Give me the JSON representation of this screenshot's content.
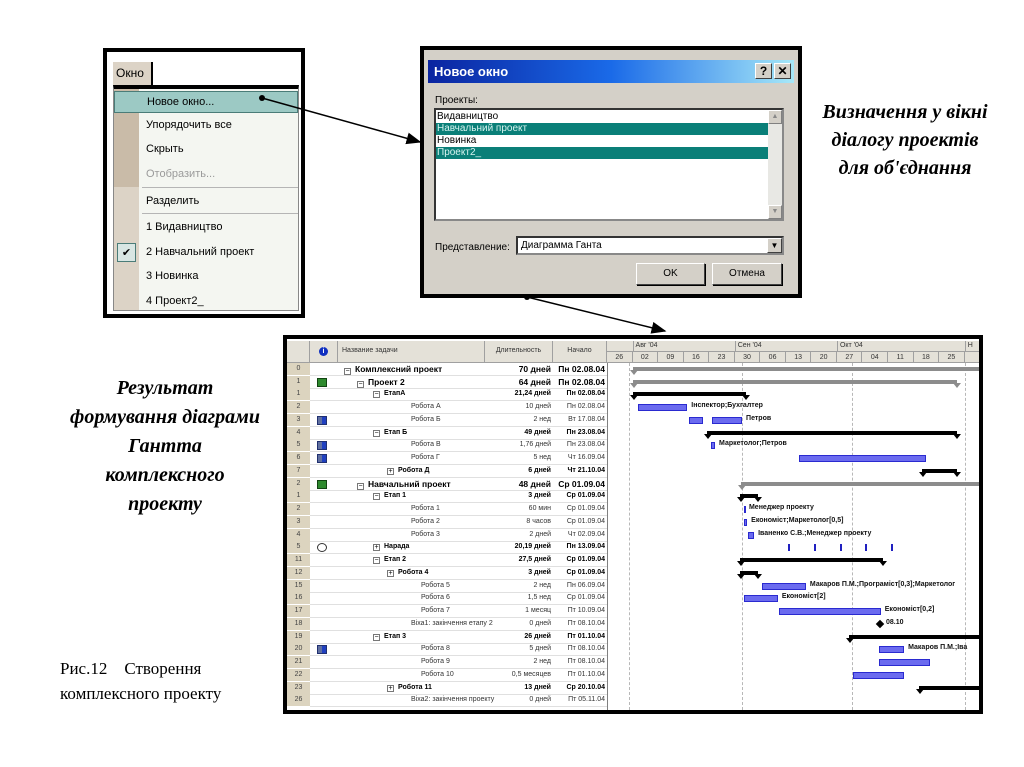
{
  "menu": {
    "tab_label": "Окно",
    "items": [
      {
        "label": "Новое окно...",
        "state": "highlighted"
      },
      {
        "label": "Упорядочить все",
        "state": "normal"
      },
      {
        "label": "Скрыть",
        "state": "normal"
      },
      {
        "label": "Отобразить...",
        "state": "disabled"
      },
      {
        "label": "Разделить",
        "state": "normal"
      },
      {
        "label": "1 Видавництво",
        "state": "normal"
      },
      {
        "label": "2 Навчальний проект",
        "state": "checked"
      },
      {
        "label": "3 Новинка",
        "state": "normal"
      },
      {
        "label": "4 Проект2_",
        "state": "normal"
      }
    ],
    "check_glyph": "✔"
  },
  "dialog": {
    "title": "Новое окно",
    "help_glyph": "?",
    "close_glyph": "✕",
    "projects_label": "Проекты:",
    "projects": [
      {
        "label": "Видавництво",
        "selected": false
      },
      {
        "label": "Навчальний проект",
        "selected": true
      },
      {
        "label": "Новинка",
        "selected": false
      },
      {
        "label": "Проект2_",
        "selected": true
      }
    ],
    "view_label": "Представление:",
    "view_value": "Диаграмма Ганта",
    "ok_label": "OK",
    "cancel_label": "Отмена"
  },
  "texts": {
    "right": "Визначення у вікні діалогу проектів для об'єднання",
    "left": "Результат формування діаграми Гантта комплексного проекту",
    "caption_1": "Рис.12    Створення",
    "caption_2": "комплексного проекту"
  },
  "gantt": {
    "headers": {
      "info_icon": "i",
      "name": "Название задачи",
      "duration": "Длительность",
      "start": "Начало"
    },
    "months": [
      {
        "label": "Авг '04",
        "day": 7
      },
      {
        "label": "Сен '04",
        "day": 35
      },
      {
        "label": "Окт '04",
        "day": 63
      },
      {
        "label": "Н",
        "day": 98
      }
    ],
    "weeks": [
      "26",
      "02",
      "09",
      "16",
      "23",
      "30",
      "06",
      "13",
      "20",
      "27",
      "04",
      "11",
      "18",
      "25"
    ],
    "month_lines": [
      6,
      37,
      67,
      98
    ],
    "colors": {
      "task": "#6b6bef",
      "summary": "#000000",
      "project": "#8c8c8c"
    },
    "rows": [
      {
        "id": "0",
        "ind": "",
        "name": "Комплексний проект",
        "lvl": 0,
        "box": "−",
        "b": true,
        "big": true,
        "dur": "70 дней",
        "start": "Пн 02.08.04",
        "g": {
          "t": "project",
          "s": 7,
          "e": 103
        }
      },
      {
        "id": "1",
        "ind": "project",
        "name": "Проект 2",
        "lvl": 1,
        "box": "−",
        "b": true,
        "big": true,
        "dur": "64 дней",
        "start": "Пн 02.08.04",
        "g": {
          "t": "project",
          "s": 7,
          "e": 96
        }
      },
      {
        "id": "1",
        "ind": "",
        "name": "ЕтапА",
        "lvl": 2,
        "box": "−",
        "b": true,
        "dur": "21,24 дней",
        "start": "Пн 02.08.04",
        "g": {
          "t": "summary",
          "s": 7,
          "e": 38
        }
      },
      {
        "id": "2",
        "ind": "",
        "name": "Робота А",
        "lvl": 3,
        "dur": "10 дней",
        "start": "Пн 02.08.04",
        "g": {
          "t": "task",
          "s": 8.5,
          "e": 22,
          "label": "Інспектор;Бухгалтер"
        }
      },
      {
        "id": "3",
        "ind": "calendar",
        "name": "Робота Б",
        "lvl": 3,
        "dur": "2 нед",
        "start": "Вт 17.08.04",
        "g": {
          "t": "split",
          "segs": [
            [
              22.5,
              26.3
            ],
            [
              28.8,
              37
            ]
          ],
          "label": "Петров"
        }
      },
      {
        "id": "4",
        "ind": "",
        "name": "Етап Б",
        "lvl": 2,
        "box": "−",
        "b": true,
        "dur": "49 дней",
        "start": "Пн 23.08.04",
        "g": {
          "t": "summary",
          "s": 27.4,
          "e": 96
        }
      },
      {
        "id": "5",
        "ind": "calendar",
        "name": "Робота В",
        "lvl": 3,
        "dur": "1,76 дней",
        "start": "Пн 23.08.04",
        "g": {
          "t": "task",
          "s": 28.5,
          "e": 29.6,
          "label": "Маркетолог;Петров"
        }
      },
      {
        "id": "6",
        "ind": "calendar",
        "name": "Робота Г",
        "lvl": 3,
        "dur": "5 нед",
        "start": "Чт 16.09.04",
        "g": {
          "t": "task",
          "s": 52.6,
          "e": 87.4
        }
      },
      {
        "id": "7",
        "ind": "",
        "name": "Робота Д",
        "lvl": 3,
        "box": "+",
        "b": true,
        "dur": "6 дней",
        "start": "Чт 21.10.04",
        "g": {
          "t": "summary",
          "s": 86.3,
          "e": 96
        }
      },
      {
        "id": "2",
        "ind": "project",
        "name": "Навчальний проект",
        "lvl": 1,
        "box": "−",
        "b": true,
        "big": true,
        "dur": "48 дней",
        "start": "Ср 01.09.04",
        "g": {
          "t": "project",
          "s": 36.7,
          "e": 103
        }
      },
      {
        "id": "1",
        "ind": "",
        "name": "Етап 1",
        "lvl": 2,
        "box": "−",
        "b": true,
        "dur": "3 дней",
        "start": "Ср 01.09.04",
        "g": {
          "t": "summary",
          "s": 36.4,
          "e": 41.4
        }
      },
      {
        "id": "2",
        "ind": "",
        "name": "Робота 1",
        "lvl": 3,
        "dur": "60 мин",
        "start": "Ср 01.09.04",
        "g": {
          "t": "task",
          "s": 37.5,
          "e": 37.8,
          "label": "Менеджер проекту"
        }
      },
      {
        "id": "3",
        "ind": "",
        "name": "Робота 2",
        "lvl": 3,
        "dur": "8 часов",
        "start": "Ср 01.09.04",
        "g": {
          "t": "task",
          "s": 37.5,
          "e": 38.4,
          "label": "Економіст;Маркетолог[0,5]"
        }
      },
      {
        "id": "4",
        "ind": "",
        "name": "Робота 3",
        "lvl": 3,
        "dur": "2 дней",
        "start": "Чт 02.09.04",
        "g": {
          "t": "task",
          "s": 38.6,
          "e": 40.3,
          "label": "Іваненко С.В.;Менеджер проекту"
        }
      },
      {
        "id": "5",
        "ind": "recurring",
        "name": "Нарада",
        "lvl": 2,
        "box": "+",
        "b": true,
        "dur": "20,19 дней",
        "start": "Пн 13.09.04",
        "g": {
          "t": "ticks",
          "days": [
            49.6,
            56.7,
            63.8,
            70.7,
            77.8
          ]
        }
      },
      {
        "id": "11",
        "ind": "",
        "name": "Етап 2",
        "lvl": 2,
        "box": "−",
        "b": true,
        "dur": "27,5 дней",
        "start": "Ср 01.09.04",
        "g": {
          "t": "summary",
          "s": 36.4,
          "e": 75.6
        }
      },
      {
        "id": "12",
        "ind": "",
        "name": "Робота 4",
        "lvl": 3,
        "box": "+",
        "b": true,
        "dur": "3 дней",
        "start": "Ср 01.09.04",
        "g": {
          "t": "summary",
          "s": 36.4,
          "e": 41.4
        }
      },
      {
        "id": "15",
        "ind": "",
        "name": "Робота 5",
        "lvl": 4,
        "dur": "2 нед",
        "start": "Пн 06.09.04",
        "g": {
          "t": "task",
          "s": 42.5,
          "e": 54.5,
          "label": "Макаров П.М.;Програміст[0,3];Маркетолог"
        }
      },
      {
        "id": "16",
        "ind": "",
        "name": "Робота 6",
        "lvl": 4,
        "dur": "1,5 нед",
        "start": "Ср 01.09.04",
        "g": {
          "t": "task",
          "s": 37.5,
          "e": 46.8,
          "label": "Економіст[2]"
        }
      },
      {
        "id": "17",
        "ind": "",
        "name": "Робота 7",
        "lvl": 4,
        "dur": "1 месяц",
        "start": "Пт 10.09.04",
        "g": {
          "t": "task",
          "s": 47.1,
          "e": 75,
          "label": "Економіст[0,2]"
        }
      },
      {
        "id": "18",
        "ind": "",
        "name": "Віха1: закінчення етапу 2",
        "lvl": 3,
        "dur": "0 дней",
        "start": "Пт 08.10.04",
        "g": {
          "t": "milestone",
          "s": 74.8,
          "label": "08.10"
        }
      },
      {
        "id": "19",
        "ind": "",
        "name": "Етап 3",
        "lvl": 2,
        "box": "−",
        "b": true,
        "dur": "26 дней",
        "start": "Пт 01.10.04",
        "g": {
          "t": "summary",
          "s": 66.3,
          "e": 103
        }
      },
      {
        "id": "20",
        "ind": "calendar",
        "name": "Робота 8",
        "lvl": 4,
        "dur": "5 дней",
        "start": "Пт 08.10.04",
        "g": {
          "t": "task",
          "s": 74.5,
          "e": 81.4,
          "label": "Макаров П.М.;Іва"
        }
      },
      {
        "id": "21",
        "ind": "",
        "name": "Робота 9",
        "lvl": 4,
        "dur": "2 нед",
        "start": "Пт 08.10.04",
        "g": {
          "t": "task",
          "s": 74.5,
          "e": 88.5
        }
      },
      {
        "id": "22",
        "ind": "",
        "name": "Робота 10",
        "lvl": 4,
        "dur": "0,5 месяцев",
        "start": "Пт 01.10.04",
        "g": {
          "t": "task",
          "s": 67.4,
          "e": 81.4
        }
      },
      {
        "id": "23",
        "ind": "",
        "name": "Робота 11",
        "lvl": 3,
        "box": "+",
        "b": true,
        "dur": "13 дней",
        "start": "Ср 20.10.04",
        "g": {
          "t": "summary",
          "s": 85.5,
          "e": 103
        }
      },
      {
        "id": "26",
        "ind": "",
        "name": "Віха2: закінчення проекту",
        "lvl": 3,
        "dur": "0 дней",
        "start": "Пт 05.11.04",
        "g": {
          "t": "none"
        }
      }
    ]
  }
}
